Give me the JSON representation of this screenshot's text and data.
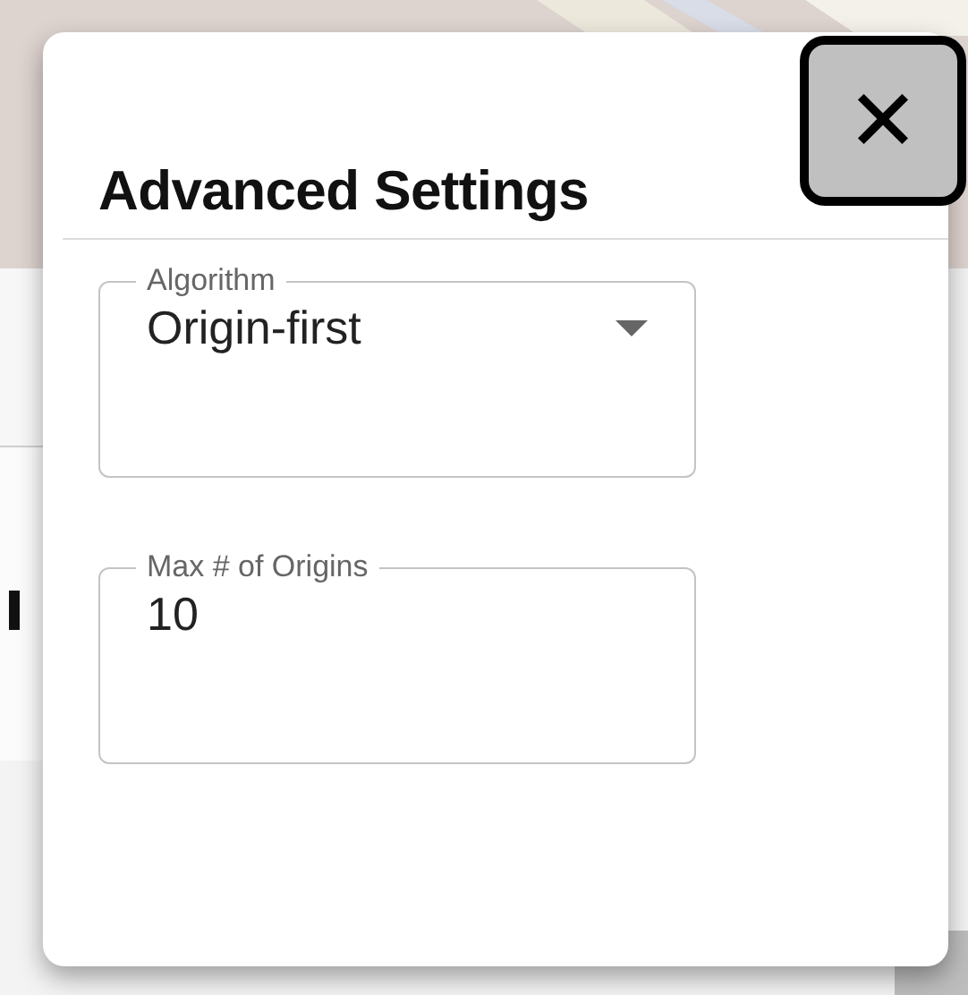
{
  "dialog": {
    "title": "Advanced Settings",
    "close": {
      "label": "✕"
    },
    "fields": [
      {
        "kind": "select",
        "label": "Algorithm",
        "value": "Origin-first"
      },
      {
        "kind": "text",
        "label": "Max # of Origins",
        "value": "10"
      }
    ]
  }
}
